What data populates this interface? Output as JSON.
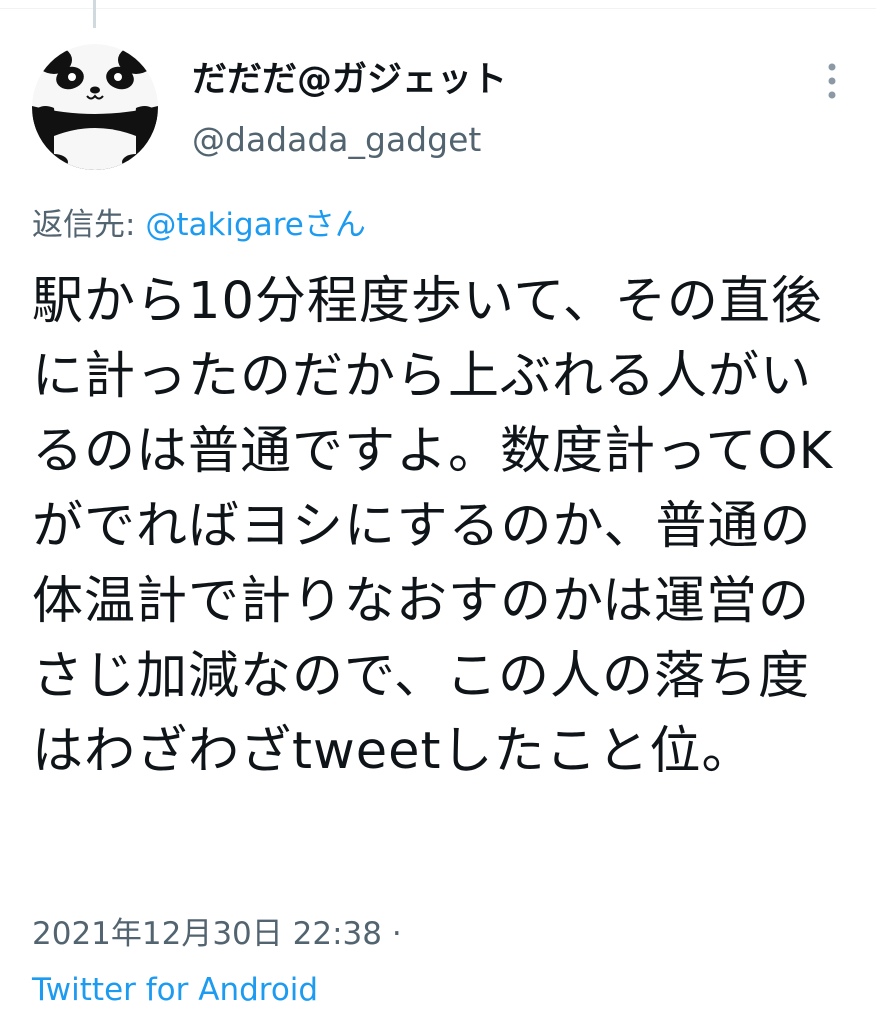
{
  "author": {
    "display_name": "だだだ@ガジェット",
    "handle": "@dadada_gadget",
    "avatar_icon": "panda-icon"
  },
  "reply": {
    "prefix": "返信先: ",
    "mention": "@takigareさん"
  },
  "tweet": {
    "text": "駅から10分程度歩いて、その直後に計ったのだから上ぶれる人がいるのは普通ですよ。数度計ってOKがでればヨシにするのか、普通の体温計で計りなおすのかは運営のさじ加減なので、この人の落ち度はわざわざtweetしたこと位。"
  },
  "meta": {
    "timestamp": "2021年12月30日 22:38 ·",
    "source": "Twitter for Android"
  },
  "icons": {
    "more": "more-vertical-icon"
  },
  "colors": {
    "text": "#0f1419",
    "secondary": "#536471",
    "link": "#1d9bf0",
    "thread_line": "#cfd9de"
  }
}
